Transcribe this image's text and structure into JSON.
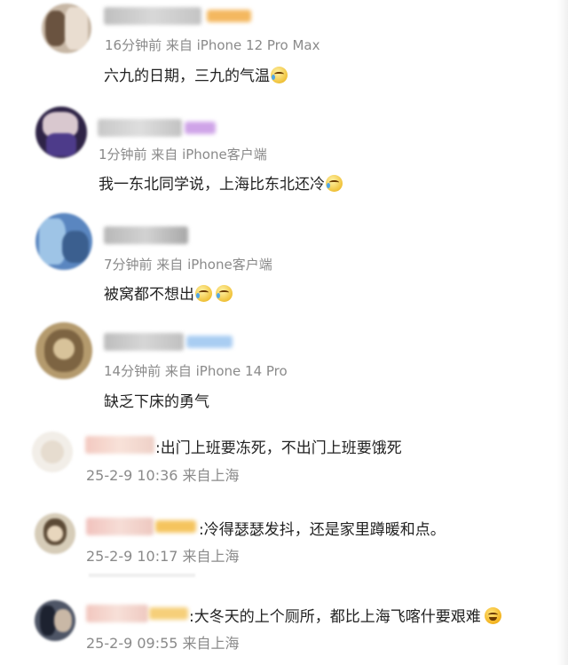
{
  "comments": [
    {
      "meta": "16分钟前  来自 iPhone 12 Pro Max",
      "text": "六九的日期，三九的气温",
      "emoji_icon": "laugh-cry-emoji"
    },
    {
      "meta": "1分钟前  来自 iPhone客户端",
      "text": "我一东北同学说，上海比东北还冷",
      "emoji_icon": "crying-emoji"
    },
    {
      "meta": "7分钟前  来自 iPhone客户端",
      "text": "被窝都不想出",
      "emoji_icon": "laugh-cry-emoji"
    },
    {
      "meta": "14分钟前  来自 iPhone 14 Pro",
      "text": "缺乏下床的勇气"
    },
    {
      "meta": "25-2-9 10:36 来自上海",
      "text": ":出门上班要冻死，不出门上班要饿死"
    },
    {
      "meta": "25-2-9 10:17 来自上海",
      "text": ":冷得瑟瑟发抖，还是家里蹲暖和点。"
    },
    {
      "meta": "25-2-9 09:55 来自上海",
      "text": ":大冬天的上个厕所，都比上海飞喀什要艰难",
      "emoji_icon": "kiss-emoji"
    }
  ]
}
